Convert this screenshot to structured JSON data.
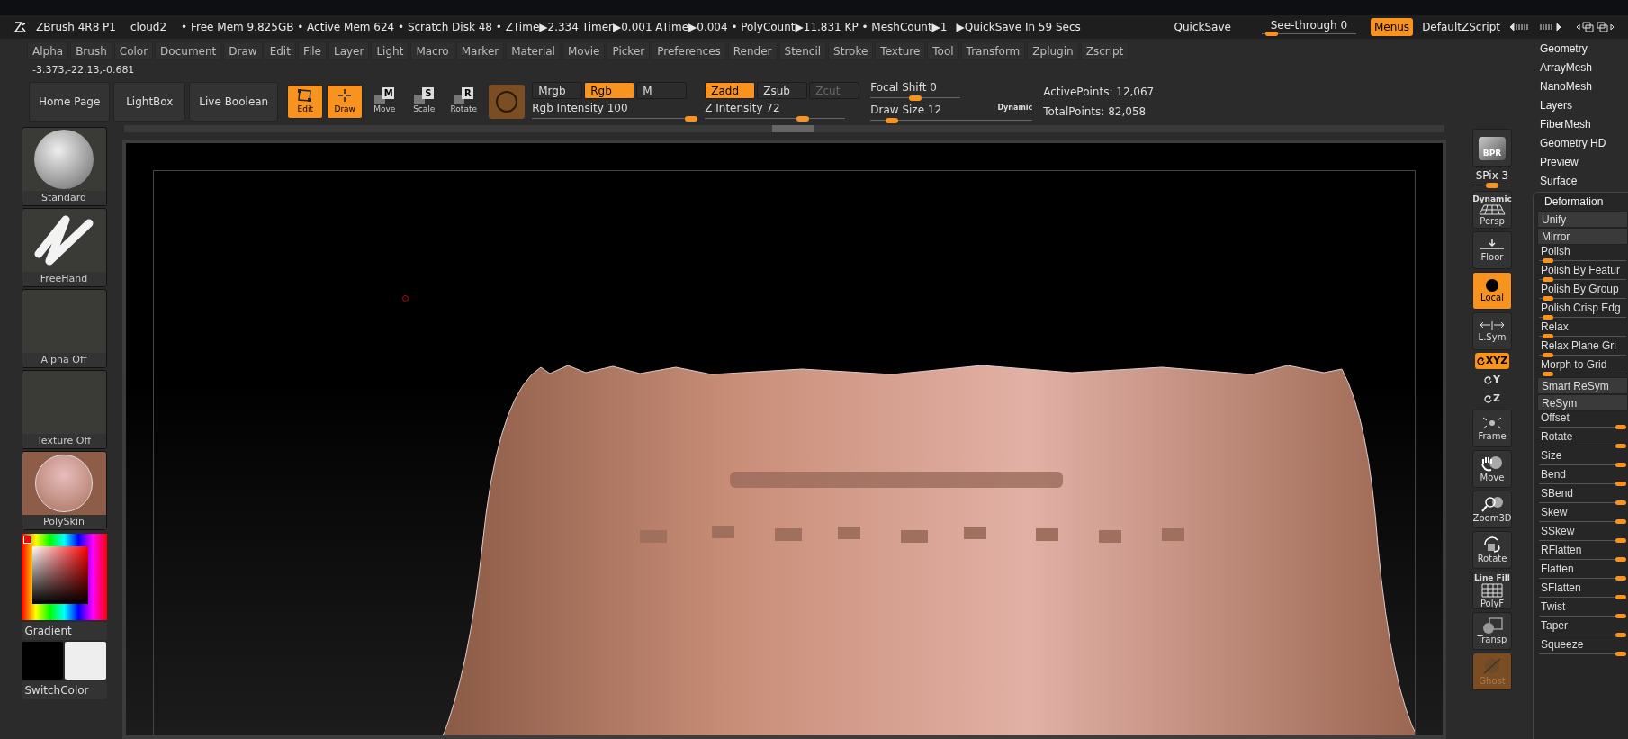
{
  "title_bar": {
    "app": "ZBrush 4R8 P1",
    "document": "cloud2",
    "stats": "• Free Mem 9.825GB • Active Mem 624 • Scratch Disk 48 •  ZTime▶2.334 Timer▶0.001 ATime▶0.004 • PolyCount▶11.831 KP • MeshCount▶1",
    "quicksave_status": "▶QuickSave In 59 Secs",
    "quicksave_button": "QuickSave",
    "see_through": {
      "label": "See-through",
      "value": "0",
      "level": 0.05
    },
    "menus_button": {
      "label": "Menus",
      "on": true
    },
    "script": "DefaultZScript"
  },
  "menus": [
    "Alpha",
    "Brush",
    "Color",
    "Document",
    "Draw",
    "Edit",
    "File",
    "Layer",
    "Light",
    "Macro",
    "Marker",
    "Material",
    "Movie",
    "Picker",
    "Preferences",
    "Render",
    "Stencil",
    "Stroke",
    "Texture",
    "Tool",
    "Transform",
    "Zplugin",
    "Zscript"
  ],
  "coordinates": "-3.373,-22.13,-0.681",
  "toolbar": {
    "buttons": [
      "Home Page",
      "LightBox",
      "Live Boolean"
    ],
    "modes": [
      {
        "kind": "edit",
        "label": "Edit",
        "selected": true
      },
      {
        "kind": "draw",
        "label": "Draw",
        "selected": true
      },
      {
        "kind": "letter",
        "letter": "M",
        "label": "Move",
        "selected": false
      },
      {
        "kind": "letter",
        "letter": "S",
        "label": "Scale",
        "selected": false
      },
      {
        "kind": "letter",
        "letter": "R",
        "label": "Rotate",
        "selected": false
      }
    ],
    "color_toggles": [
      {
        "label": "Mrgb",
        "on": false,
        "disabled": false
      },
      {
        "label": "Rgb",
        "on": true,
        "disabled": false
      },
      {
        "label": "M",
        "on": false,
        "disabled": false
      }
    ],
    "depth_toggles": [
      {
        "label": "Zadd",
        "on": true,
        "disabled": false
      },
      {
        "label": "Zsub",
        "on": false,
        "disabled": false
      },
      {
        "label": "Zcut",
        "on": false,
        "disabled": true
      }
    ],
    "rgb_intensity": {
      "label": "Rgb Intensity",
      "value": "100",
      "level": 1
    },
    "z_intensity": {
      "label": "Z Intensity",
      "value": "72",
      "level": 0.72
    },
    "focal_shift": {
      "label": "Focal Shift",
      "value": "0",
      "level": 0.5
    },
    "draw_size": {
      "label": "Draw Size",
      "value": "12",
      "level": 0.1,
      "dynamic": "Dynamic"
    },
    "active_points": "ActivePoints: 12,067",
    "total_points": "TotalPoints: 82,058"
  },
  "left_tray": {
    "tiles": [
      {
        "kind": "brush",
        "label": "Standard"
      },
      {
        "kind": "stroke",
        "label": "FreeHand"
      },
      {
        "kind": "empty",
        "label": "Alpha Off"
      },
      {
        "kind": "empty",
        "label": "Texture Off"
      },
      {
        "kind": "material",
        "label": "PolySkin"
      }
    ],
    "gradient": "Gradient",
    "switch_color": "SwitchColor"
  },
  "shelf": [
    {
      "kind": "bpr",
      "label": "BPR",
      "on": false
    },
    {
      "kind": "spix",
      "label": "SPix 3",
      "level": 0.5
    },
    {
      "kind": "persp",
      "label": "Persp",
      "top": "Dynamic",
      "on": false
    },
    {
      "kind": "floor",
      "label": "Floor",
      "on": false
    },
    {
      "kind": "local",
      "label": "Local",
      "on": true
    },
    {
      "kind": "lsym",
      "label": "L.Sym",
      "on": false
    },
    {
      "kind": "axis",
      "label": "XYZ",
      "on": true
    },
    {
      "kind": "axis",
      "label": "Y",
      "on": false
    },
    {
      "kind": "axis",
      "label": "Z",
      "on": false
    },
    {
      "kind": "frame",
      "label": "Frame",
      "on": false
    },
    {
      "kind": "move",
      "label": "Move",
      "on": false
    },
    {
      "kind": "zoom",
      "label": "Zoom3D",
      "on": false
    },
    {
      "kind": "rotate",
      "label": "Rotate",
      "on": false
    },
    {
      "kind": "polyf",
      "label": "PolyF",
      "top": "Line Fill",
      "on": false
    },
    {
      "kind": "transp",
      "label": "Transp",
      "on": false
    },
    {
      "kind": "ghost",
      "label": "Ghost",
      "on": true
    }
  ],
  "tool_panel": {
    "subpalettes": [
      "Geometry",
      "ArrayMesh",
      "NanoMesh",
      "Layers",
      "FiberMesh",
      "Geometry HD",
      "Preview",
      "Surface"
    ],
    "open_section": "Deformation",
    "items": [
      {
        "kind": "button",
        "label": "Unify"
      },
      {
        "kind": "button",
        "label": "Mirror"
      },
      {
        "kind": "slider",
        "label": "Polish",
        "level": 0.05
      },
      {
        "kind": "slider",
        "label": "Polish By Featur",
        "level": 0.05
      },
      {
        "kind": "slider",
        "label": "Polish By Group",
        "level": 0.05
      },
      {
        "kind": "slider",
        "label": "Polish Crisp Edg",
        "level": 0.05
      },
      {
        "kind": "slider",
        "label": "Relax",
        "level": 0.05
      },
      {
        "kind": "slider",
        "label": "Relax Plane Gri",
        "level": 0.05
      },
      {
        "kind": "slider",
        "label": "Morph to Grid",
        "level": 0.05
      },
      {
        "kind": "button",
        "label": "Smart ReSym"
      },
      {
        "kind": "button",
        "label": "ReSym"
      },
      {
        "kind": "slider",
        "label": "Offset",
        "level": 1
      },
      {
        "kind": "slider",
        "label": "Rotate",
        "level": 1
      },
      {
        "kind": "slider",
        "label": "Size",
        "level": 1
      },
      {
        "kind": "slider",
        "label": "Bend",
        "level": 1
      },
      {
        "kind": "slider",
        "label": "SBend",
        "level": 1
      },
      {
        "kind": "slider",
        "label": "Skew",
        "level": 1
      },
      {
        "kind": "slider",
        "label": "SSkew",
        "level": 1
      },
      {
        "kind": "slider",
        "label": "RFlatten",
        "level": 1
      },
      {
        "kind": "slider",
        "label": "Flatten",
        "level": 1
      },
      {
        "kind": "slider",
        "label": "SFlatten",
        "level": 1
      },
      {
        "kind": "slider",
        "label": "Twist",
        "level": 1
      },
      {
        "kind": "slider",
        "label": "Taper",
        "level": 1
      },
      {
        "kind": "slider",
        "label": "Squeeze",
        "level": 1
      }
    ]
  }
}
